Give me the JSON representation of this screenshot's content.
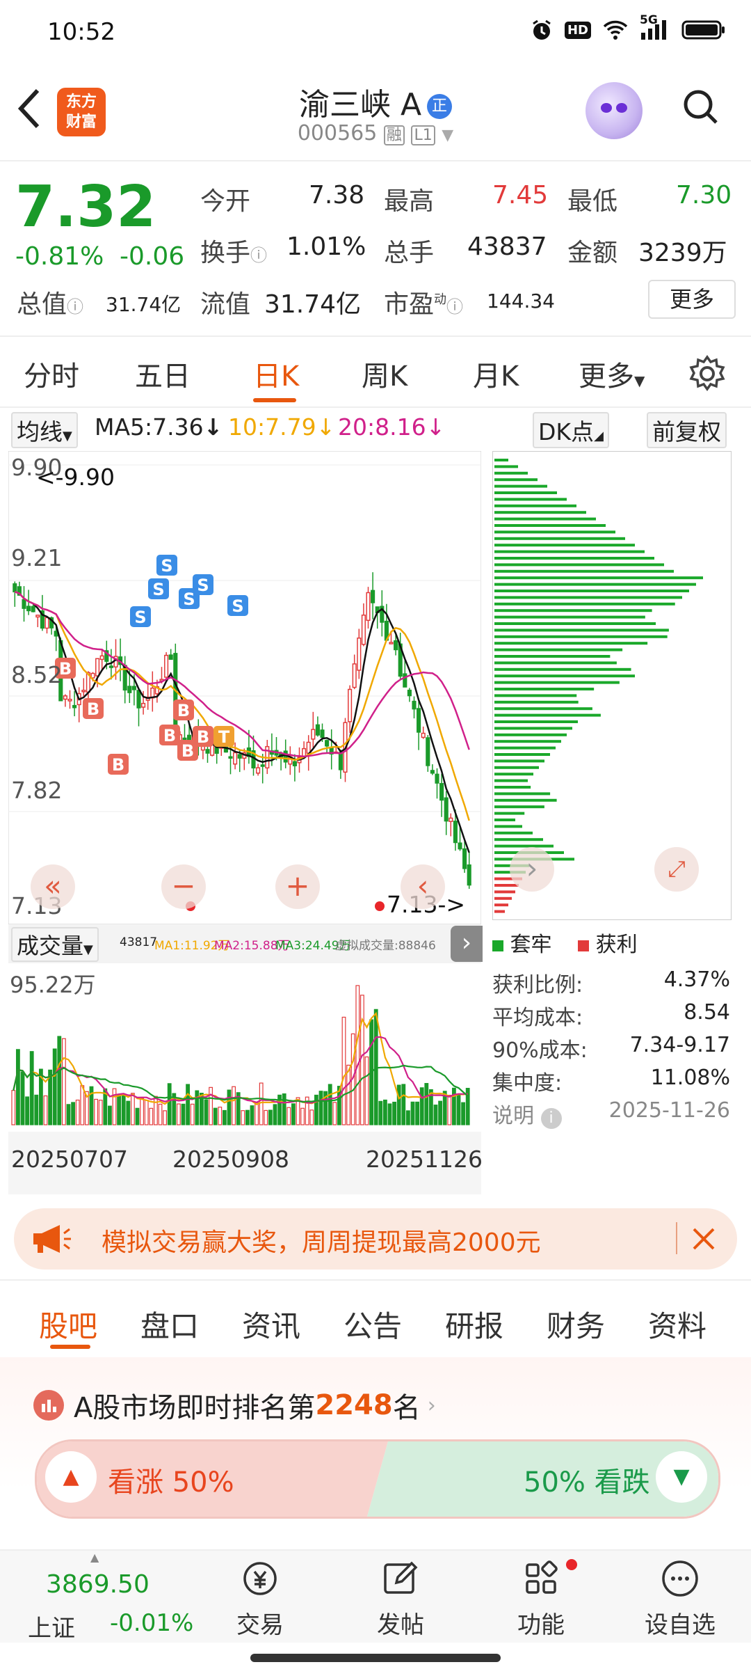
{
  "status_bar": {
    "time": "10:52",
    "icons": [
      "alarm-icon",
      "hd-icon",
      "wifi-icon",
      "5g-icon",
      "battery-icon"
    ],
    "network": "5G",
    "hd": "HD"
  },
  "header": {
    "logo_line1": "东方",
    "logo_line2": "财富",
    "stock_name": "渝三峡 A",
    "reg_badge": "正",
    "code": "000565",
    "margin_badge": "融",
    "level_badge": "L1"
  },
  "quote": {
    "price": "7.32",
    "change_pct": "-0.81%",
    "change": "-0.06",
    "open_label": "今开",
    "open": "7.38",
    "high_label": "最高",
    "high": "7.45",
    "low_label": "最低",
    "low": "7.30",
    "turnover_label": "换手",
    "turnover": "1.01%",
    "volume_label": "总手",
    "volume": "43837",
    "amount_label": "金额",
    "amount": "3239万",
    "mktcap_label": "总值",
    "mktcap": "31.74亿",
    "float_label": "流值",
    "float": "31.74亿",
    "pe_label": "市盈",
    "pe_sup": "动",
    "pe": "144.34",
    "more": "更多"
  },
  "tabs": [
    "分时",
    "五日",
    "日K",
    "周K",
    "月K",
    "更多"
  ],
  "active_tab": "日K",
  "ma_row": {
    "selector": "均线",
    "ma5": "MA5:7.36",
    "ma10": "10:7.79",
    "ma20": "20:8.16",
    "dk": "DK点",
    "adjust": "前复权"
  },
  "colors": {
    "up": "#e23a3a",
    "down": "#1a9a2a",
    "accent": "#e8570e",
    "ma5": "#111111",
    "ma10": "#f0a800",
    "ma20": "#d0208a"
  },
  "kline": {
    "y_ticks": [
      "9.90",
      "9.21",
      "8.52",
      "7.82",
      "7.13"
    ],
    "max_note": "<-9.90",
    "min_note": "7.13->",
    "markers": [
      "B",
      "B",
      "B",
      "B",
      "B",
      "B",
      "B",
      "T",
      "S",
      "S",
      "S",
      "S",
      "S",
      "S"
    ]
  },
  "volume": {
    "selector": "成交量",
    "legend_vol": "43817",
    "legend_ma1": "MA1:11.92万",
    "legend_ma2": "MA2:15.88万",
    "legend_ma3": "MA3:24.49万",
    "legend_virtual": "虚拟成交量:88846",
    "max_label": "95.22万",
    "dates": [
      "20250707",
      "20250908",
      "20251126"
    ]
  },
  "chip": {
    "legend_trapped": "套牢",
    "legend_profit": "获利",
    "rows": [
      {
        "label": "获利比例:",
        "value": "4.37%"
      },
      {
        "label": "平均成本:",
        "value": "8.54"
      },
      {
        "label": "90%成本:",
        "value": "7.34-9.17"
      },
      {
        "label": "集中度:",
        "value": "11.08%"
      }
    ],
    "note": "说明",
    "date": "2025-11-26"
  },
  "banner": {
    "text": "模拟交易赢大奖，周周提现最高2000元"
  },
  "bottom_tabs": [
    "股吧",
    "盘口",
    "资讯",
    "公告",
    "研报",
    "财务",
    "资料"
  ],
  "rank": {
    "prefix": "A股市场即时排名第",
    "rank": "2248",
    "suffix": "名"
  },
  "vote": {
    "up_label": "看涨 50%",
    "down_label": "50% 看跌",
    "up_pct": 50
  },
  "navbar": {
    "index_value": "3869.50",
    "index_name": "上证",
    "index_change": "-0.01%",
    "items": [
      "交易",
      "发帖",
      "功能",
      "设自选"
    ]
  }
}
